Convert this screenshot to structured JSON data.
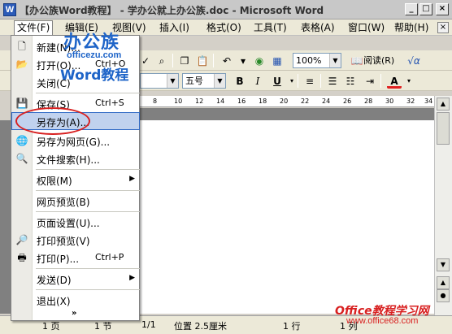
{
  "window": {
    "icon": "W",
    "title": "【办公族Word教程】 - 学办公就上办公族.doc - Microsoft Word",
    "min_label": "_",
    "max_label": "□",
    "close_label": "×"
  },
  "menubar": {
    "items": [
      "文件(F)",
      "编辑(E)",
      "视图(V)",
      "插入(I)",
      "格式(O)",
      "工具(T)",
      "表格(A)",
      "窗口(W)",
      "帮助(H)"
    ],
    "close_label": "×"
  },
  "toolbar1": {
    "zoom": "100%",
    "read_label": "阅读(R)"
  },
  "toolbar2": {
    "font_size": "五号",
    "bold": "B",
    "italic": "I",
    "underline": "U",
    "font_color": "A"
  },
  "ruler": {
    "ticks": [
      "8",
      "10",
      "12",
      "14",
      "16",
      "18",
      "20",
      "22",
      "24",
      "26",
      "28",
      "30",
      "32",
      "34"
    ]
  },
  "file_menu": {
    "items": [
      {
        "label": "新建(N)...",
        "shortcut": "",
        "icon": "new-doc-icon"
      },
      {
        "label": "打开(O)...",
        "shortcut": "Ctrl+O",
        "icon": "open-folder-icon"
      },
      {
        "label": "关闭(C)",
        "shortcut": "",
        "icon": ""
      },
      {
        "label": "保存(S)",
        "shortcut": "Ctrl+S",
        "icon": "save-icon"
      },
      {
        "label": "另存为(A)...",
        "shortcut": "",
        "icon": "",
        "highlighted": true
      },
      {
        "label": "另存为网页(G)...",
        "shortcut": "",
        "icon": "web-save-icon"
      },
      {
        "label": "文件搜索(H)...",
        "shortcut": "",
        "icon": "search-icon"
      },
      {
        "label": "权限(M)",
        "shortcut": "",
        "icon": "",
        "submenu": true
      },
      {
        "label": "网页预览(B)",
        "shortcut": "",
        "icon": ""
      },
      {
        "label": "页面设置(U)...",
        "shortcut": "",
        "icon": ""
      },
      {
        "label": "打印预览(V)",
        "shortcut": "",
        "icon": "print-preview-icon"
      },
      {
        "label": "打印(P)...",
        "shortcut": "Ctrl+P",
        "icon": "printer-icon"
      },
      {
        "label": "发送(D)",
        "shortcut": "",
        "icon": "",
        "submenu": true
      },
      {
        "label": "退出(X)",
        "shortcut": "",
        "icon": ""
      }
    ],
    "expand_label": "»"
  },
  "statusbar": {
    "page": "1 页",
    "section": "1 节",
    "page_of": "1/1",
    "position": "位置 2.5厘米",
    "line": "1 行",
    "column": "1 列"
  },
  "watermark_top": {
    "line1": "办公族",
    "line2": "officezu.com",
    "line3": "Word教程"
  },
  "watermark_bottom": {
    "line1": "Office教程学习网",
    "line2": "www.office68.com"
  },
  "colors": {
    "highlight_bg": "#c1d2ee",
    "highlight_border": "#316ac5",
    "annotation_red": "#d82020",
    "watermark_blue": "#1e64c8"
  }
}
